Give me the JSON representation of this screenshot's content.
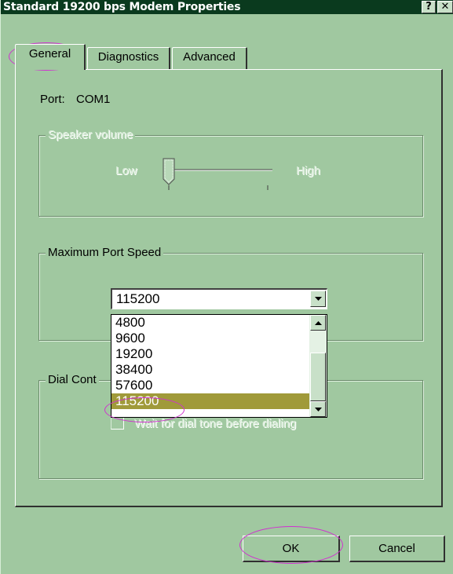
{
  "window": {
    "title": "Standard 19200 bps Modem Properties",
    "help_label": "?",
    "close_label": "✕"
  },
  "tabs": [
    {
      "label": "General",
      "active": true
    },
    {
      "label": "Diagnostics",
      "active": false
    },
    {
      "label": "Advanced",
      "active": false
    }
  ],
  "general": {
    "port_label": "Port:",
    "port_value": "COM1",
    "speaker": {
      "title": "Speaker volume",
      "low_label": "Low",
      "high_label": "High",
      "enabled": false,
      "level": 0.0
    },
    "max_speed": {
      "title": "Maximum Port Speed",
      "selected": "115200",
      "options": [
        "4800",
        "9600",
        "19200",
        "38400",
        "57600",
        "115200"
      ],
      "highlighted": "115200"
    },
    "dial_control": {
      "title": "Dial Control",
      "visible_title": "Dial Cont",
      "wait_dial_tone_label": "Wait for dial tone before dialing",
      "wait_dial_tone_checked": false
    }
  },
  "buttons": {
    "ok_label": "OK",
    "cancel_label": "Cancel"
  },
  "colors": {
    "title_bar": "#0a3a1e",
    "dialog_face": "#a0c8a0",
    "list_highlight": "#a09a3a",
    "annotation_circle": "#d030d0"
  },
  "icons": [
    "help-icon",
    "close-icon",
    "dropdown-arrow-icon",
    "scroll-up-icon",
    "scroll-down-icon",
    "slider-thumb-icon"
  ]
}
